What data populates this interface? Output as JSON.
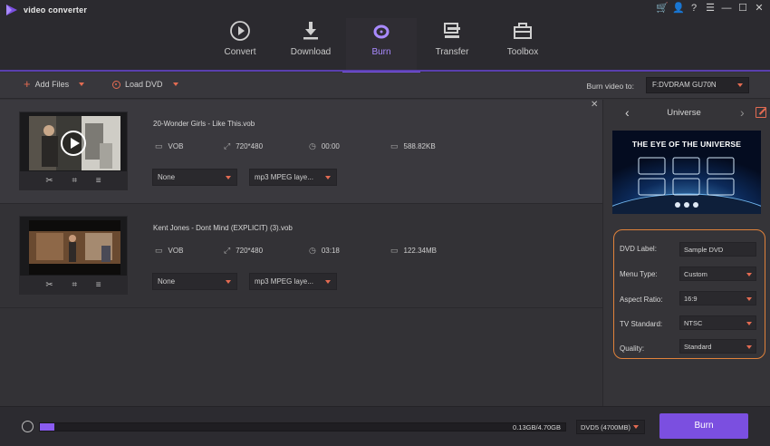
{
  "app": {
    "title": "video converter"
  },
  "window_controls": [
    "cart-icon",
    "user-icon",
    "help-icon",
    "menu-icon",
    "minimize-icon",
    "maximize-icon",
    "close-icon"
  ],
  "nav": {
    "tabs": [
      {
        "label": "Convert",
        "icon": "play-circle-icon",
        "active": false
      },
      {
        "label": "Download",
        "icon": "download-icon",
        "active": false
      },
      {
        "label": "Burn",
        "icon": "disc-icon",
        "active": true
      },
      {
        "label": "Transfer",
        "icon": "transfer-icon",
        "active": false
      },
      {
        "label": "Toolbox",
        "icon": "toolbox-icon",
        "active": false
      }
    ]
  },
  "toolbar": {
    "add_files": "Add Files",
    "load_dvd": "Load DVD",
    "burn_video_to_label": "Burn video to:",
    "burn_video_to_value": "F:DVDRAM GU70N"
  },
  "files": [
    {
      "name": "20-Wonder Girls - Like This.vob",
      "format": "VOB",
      "resolution": "720*480",
      "duration": "00:00",
      "size": "588.82KB",
      "subtitle": "None",
      "audio": "mp3 MPEG laye..."
    },
    {
      "name": "Kent Jones - Dont Mind (EXPLICIT) (3).vob",
      "format": "VOB",
      "resolution": "720*480",
      "duration": "03:18",
      "size": "122.34MB",
      "subtitle": "None",
      "audio": "mp3 MPEG laye..."
    }
  ],
  "template_panel": {
    "title": "Universe",
    "preview_title": "THE EYE OF THE UNIVERSE"
  },
  "settings": {
    "dvd_label": {
      "label": "DVD Label:",
      "value": "Sample DVD"
    },
    "menu_type": {
      "label": "Menu Type:",
      "value": "Custom"
    },
    "aspect_ratio": {
      "label": "Aspect Ratio:",
      "value": "16:9"
    },
    "tv_standard": {
      "label": "TV Standard:",
      "value": "NTSC"
    },
    "quality": {
      "label": "Quality:",
      "value": "Standard"
    }
  },
  "bottom": {
    "progress_text": "0.13GB/4.70GB",
    "progress_fraction": 0.028,
    "disc_type": "DVD5 (4700MB)",
    "burn_button": "Burn"
  },
  "colors": {
    "accent": "#7b4fe0",
    "highlight": "#e0823b",
    "icon_red": "#e36b52"
  }
}
